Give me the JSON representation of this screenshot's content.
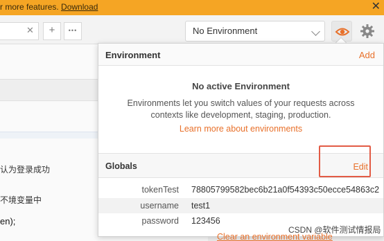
{
  "banner": {
    "text": "r more features.",
    "link": "Download",
    "close": "✕"
  },
  "tabs": {
    "close": "✕",
    "add": "+",
    "more": "•••"
  },
  "environment_selector": {
    "value": "No Environment"
  },
  "popover": {
    "title": "Environment",
    "add_label": "Add",
    "empty_title": "No active Environment",
    "description": "Environments let you switch values of your requests across contexts like development, staging, production.",
    "learn_more": "Learn more about environments",
    "globals_title": "Globals",
    "edit_label": "Edit",
    "variables": [
      {
        "key": "tokenTest",
        "value": "78805799582bec6b21a0f54393c50ecce54863c2"
      },
      {
        "key": "username",
        "value": "test1"
      },
      {
        "key": "password",
        "value": "123456"
      }
    ]
  },
  "editor": {
    "line1": "认为登录成功",
    "line2": "不境变量中",
    "line3": "en);"
  },
  "bottom": {
    "clear_link": "Clear an environment variable",
    "watermark": "CSDN @软件测试情报局"
  },
  "colors": {
    "banner": "#f5a524",
    "accent": "#e8702a",
    "highlight_box": "#e25b45"
  }
}
